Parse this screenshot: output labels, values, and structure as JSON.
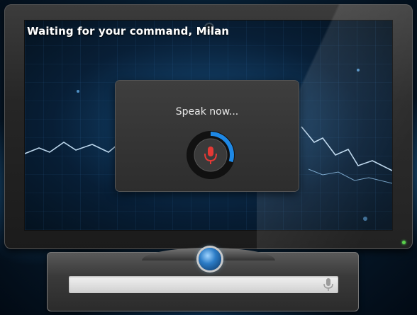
{
  "assistant": {
    "status_text": "Waiting for your command, Milan",
    "user_name": "Milan"
  },
  "voice_dialog": {
    "prompt": "Speak now...",
    "listening_progress": 0.3,
    "mic_icon": "microphone-icon",
    "mic_color": "#e53935",
    "ring_color": "#1e88e5"
  },
  "search": {
    "value": "",
    "placeholder": "",
    "mic_icon": "microphone-icon"
  },
  "theme": {
    "accent": "#3aa8ff",
    "power_led": "#5bd14c"
  }
}
